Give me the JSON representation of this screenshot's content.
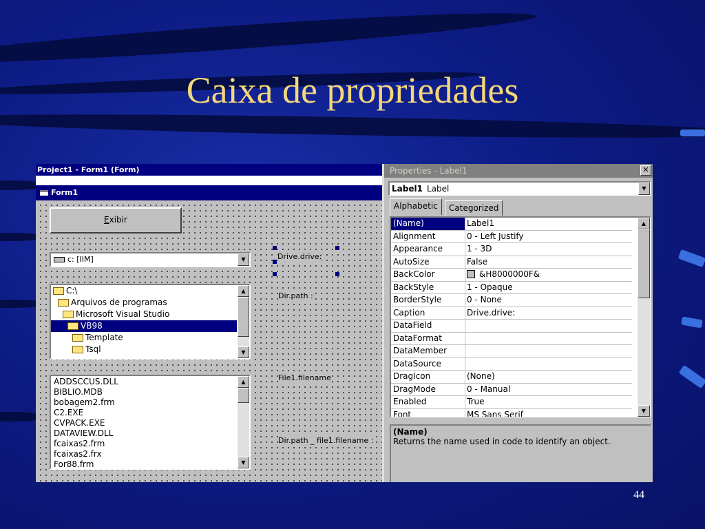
{
  "slide": {
    "title": "Caixa de propriedades",
    "number": "44"
  },
  "project_window": {
    "title": "Project1 - Form1 (Form)"
  },
  "form": {
    "title": "Form1",
    "exibir_button": "Exibir",
    "drive_combo_value": "c: [IIM]",
    "dir_list": [
      {
        "label": "C:\\",
        "indent": 0,
        "selected": false
      },
      {
        "label": "Arquivos de programas",
        "indent": 1,
        "selected": false
      },
      {
        "label": "Microsoft Visual Studio",
        "indent": 2,
        "selected": false
      },
      {
        "label": "VB98",
        "indent": 3,
        "selected": true
      },
      {
        "label": "Template",
        "indent": 4,
        "selected": false
      },
      {
        "label": "Tsql",
        "indent": 4,
        "selected": false
      }
    ],
    "file_list": [
      "ADDSCCUS.DLL",
      "BIBLIO.MDB",
      "bobagem2.frm",
      "C2.EXE",
      "CVPACK.EXE",
      "DATAVIEW.DLL",
      "fcaixas2.frm",
      "fcaixas2.frx",
      "For88.frm"
    ],
    "labels": {
      "drive": "Drive.drive:",
      "dir": "Dir.path :",
      "file": "File1.filename",
      "combined": "Dir.path  _ file1.filename :"
    }
  },
  "properties": {
    "title": "Properties - Label1",
    "object_name": "Label1",
    "object_type": "Label",
    "tabs": [
      "Alphabetic",
      "Categorized"
    ],
    "active_tab": "Alphabetic",
    "rows": [
      {
        "name": "(Name)",
        "value": "Label1",
        "selected": true
      },
      {
        "name": "Alignment",
        "value": "0 - Left Justify"
      },
      {
        "name": "Appearance",
        "value": "1 - 3D"
      },
      {
        "name": "AutoSize",
        "value": "False"
      },
      {
        "name": "BackColor",
        "value": "&H8000000F&",
        "swatch": "#c0c0c0"
      },
      {
        "name": "BackStyle",
        "value": "1 - Opaque"
      },
      {
        "name": "BorderStyle",
        "value": "0 - None"
      },
      {
        "name": "Caption",
        "value": "Drive.drive:"
      },
      {
        "name": "DataField",
        "value": ""
      },
      {
        "name": "DataFormat",
        "value": ""
      },
      {
        "name": "DataMember",
        "value": ""
      },
      {
        "name": "DataSource",
        "value": ""
      },
      {
        "name": "DragIcon",
        "value": "(None)"
      },
      {
        "name": "DragMode",
        "value": "0 - Manual"
      },
      {
        "name": "Enabled",
        "value": "True"
      },
      {
        "name": "Font",
        "value": "MS Sans Serif"
      }
    ],
    "description_title": "(Name)",
    "description_text": "Returns the name used in code to identify an object."
  },
  "colors": {
    "slide_title": "#f4d77a",
    "titlebar_active": "#000080",
    "titlebar_inactive": "#808080",
    "selection": "#000080"
  }
}
